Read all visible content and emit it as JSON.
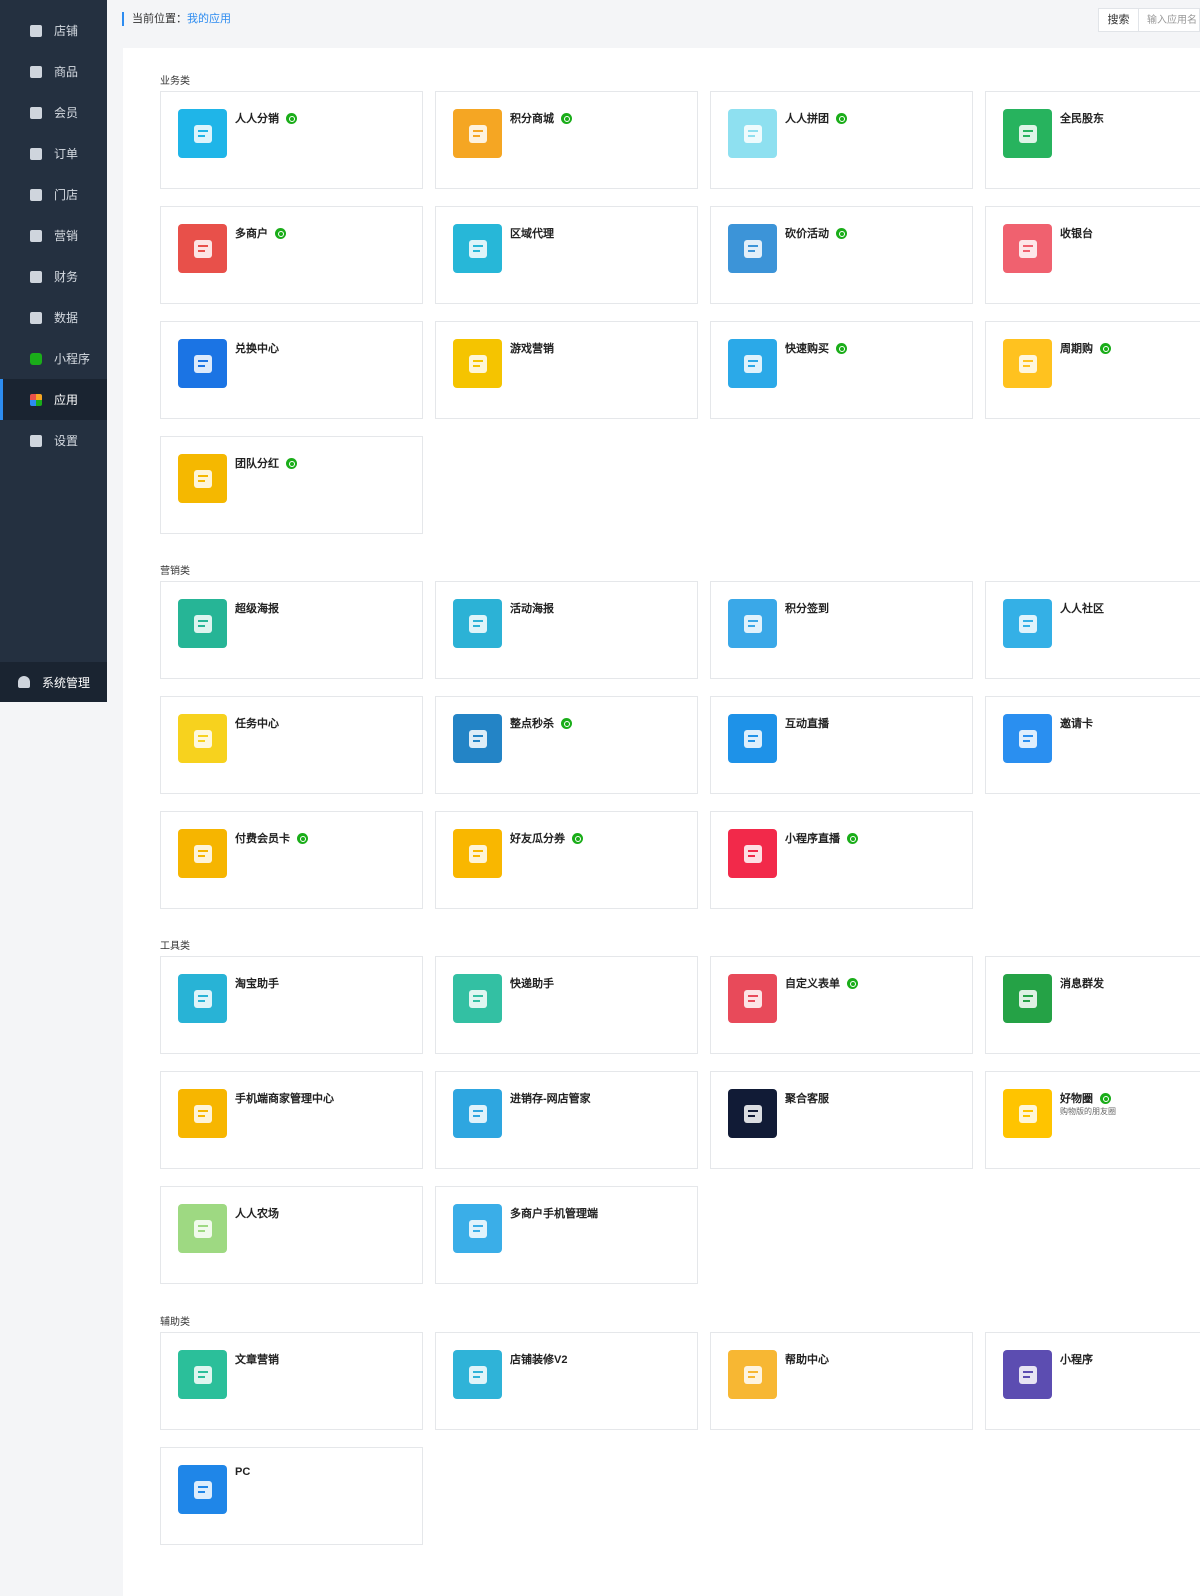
{
  "sidebar": {
    "items": [
      {
        "label": "店铺",
        "icon": "store-icon",
        "active": false
      },
      {
        "label": "商品",
        "icon": "goods-icon",
        "active": false
      },
      {
        "label": "会员",
        "icon": "user-icon",
        "active": false
      },
      {
        "label": "订单",
        "icon": "order-icon",
        "active": false
      },
      {
        "label": "门店",
        "icon": "shop-icon",
        "active": false
      },
      {
        "label": "营销",
        "icon": "gift-icon",
        "active": false
      },
      {
        "label": "财务",
        "icon": "money-bag-icon",
        "active": false
      },
      {
        "label": "数据",
        "icon": "bar-chart-icon",
        "active": false
      },
      {
        "label": "小程序",
        "icon": "miniprogram-icon",
        "active": false
      },
      {
        "label": "应用",
        "icon": "apps-grid-icon",
        "active": true
      },
      {
        "label": "设置",
        "icon": "gear-icon",
        "active": false
      }
    ],
    "bottom_label": "系统管理"
  },
  "breadcrumb": {
    "prefix": "当前位置：",
    "current": "我的应用"
  },
  "search": {
    "button_label": "搜索",
    "placeholder": "输入应用名"
  },
  "colors": {
    "sidebar_bg": "#243040",
    "accent": "#2d8cf0",
    "miniprogram_badge": "#1aad19"
  },
  "sections": [
    {
      "title": "业务类",
      "apps": [
        {
          "name": "人人分销",
          "mp": true,
          "color": "#1fb5e8",
          "icon": "distribution-icon"
        },
        {
          "name": "积分商城",
          "mp": true,
          "color": "#f5a623",
          "icon": "points-mall-icon"
        },
        {
          "name": "人人拼团",
          "mp": true,
          "color": "#8ee0f0",
          "icon": "group-buy-icon"
        },
        {
          "name": "全民股东",
          "mp": false,
          "color": "#27b35e",
          "icon": "shareholder-icon"
        },
        {
          "name": "多商户",
          "mp": true,
          "color": "#e8504a",
          "icon": "multi-merchant-icon"
        },
        {
          "name": "区域代理",
          "mp": false,
          "color": "#27b7d8",
          "icon": "map-icon"
        },
        {
          "name": "砍价活动",
          "mp": true,
          "color": "#3c94d8",
          "icon": "bargain-axe-icon"
        },
        {
          "name": "收银台",
          "mp": false,
          "color": "#f0616f",
          "icon": "cashier-icon"
        },
        {
          "name": "兑换中心",
          "mp": false,
          "color": "#1b74e4",
          "icon": "exchange-icon"
        },
        {
          "name": "游戏营销",
          "mp": false,
          "color": "#f5c400",
          "icon": "wheel-icon"
        },
        {
          "name": "快速购买",
          "mp": true,
          "color": "#2ba9e8",
          "icon": "cart-icon"
        },
        {
          "name": "周期购",
          "mp": true,
          "color": "#ffc21f",
          "icon": "calendar-icon"
        },
        {
          "name": "团队分红",
          "mp": true,
          "color": "#f5b800",
          "icon": "red-envelope-icon"
        }
      ]
    },
    {
      "title": "营销类",
      "apps": [
        {
          "name": "超级海报",
          "mp": false,
          "color": "#26b596",
          "icon": "poster-camera-icon"
        },
        {
          "name": "活动海报",
          "mp": false,
          "color": "#2cb2d6",
          "icon": "picture-icon"
        },
        {
          "name": "积分签到",
          "mp": false,
          "color": "#3aa8e8",
          "icon": "sign-pin-icon"
        },
        {
          "name": "人人社区",
          "mp": false,
          "color": "#34b0e6",
          "icon": "community-icon"
        },
        {
          "name": "任务中心",
          "mp": false,
          "color": "#f7d21e",
          "icon": "task-qrcode-icon"
        },
        {
          "name": "整点秒杀",
          "mp": true,
          "color": "#2384c6",
          "icon": "alarm-clock-icon"
        },
        {
          "name": "互动直播",
          "mp": false,
          "color": "#1e92e8",
          "icon": "tv-icon"
        },
        {
          "name": "邀请卡",
          "mp": false,
          "color": "#2a8ff0",
          "icon": "invite-card-icon"
        },
        {
          "name": "付费会员卡",
          "mp": true,
          "color": "#f6b500",
          "icon": "crown-card-icon"
        },
        {
          "name": "好友瓜分券",
          "mp": true,
          "color": "#f9b700",
          "icon": "coupon-envelope-icon"
        },
        {
          "name": "小程序直播",
          "mp": true,
          "color": "#f2294a",
          "icon": "live-tv-icon"
        }
      ]
    },
    {
      "title": "工具类",
      "apps": [
        {
          "name": "淘宝助手",
          "mp": false,
          "color": "#28b3d6",
          "icon": "taobao-face-icon"
        },
        {
          "name": "快递助手",
          "mp": false,
          "color": "#33c0a3",
          "icon": "package-icon"
        },
        {
          "name": "自定义表单",
          "mp": true,
          "color": "#e84a5a",
          "icon": "form-icon"
        },
        {
          "name": "消息群发",
          "mp": false,
          "color": "#25a246",
          "icon": "message-icon"
        },
        {
          "name": "手机端商家管理中心",
          "mp": false,
          "color": "#f7b600",
          "icon": "phone-icon"
        },
        {
          "name": "进销存-网店管家",
          "mp": false,
          "color": "#2ea6e0",
          "icon": "inventory-icon"
        },
        {
          "name": "聚合客服",
          "mp": false,
          "color": "#111b36",
          "icon": "service-face-icon"
        },
        {
          "name": "好物圈",
          "mp": true,
          "sub": "购物版的朋友圈",
          "color": "#ffc400",
          "icon": "shopping-cart-icon"
        },
        {
          "name": "人人农场",
          "mp": false,
          "color": "#9ed982",
          "icon": "chicken-icon"
        },
        {
          "name": "多商户手机管理端",
          "mp": false,
          "color": "#3aaee8",
          "icon": "mobile-manage-icon"
        }
      ]
    },
    {
      "title": "辅助类",
      "apps": [
        {
          "name": "文章营销",
          "mp": false,
          "color": "#2bbf9a",
          "icon": "article-icon"
        },
        {
          "name": "店铺装修V2",
          "mp": false,
          "color": "#2fb3d8",
          "icon": "storefront-icon"
        },
        {
          "name": "帮助中心",
          "mp": false,
          "color": "#f7b733",
          "icon": "magnifier-icon"
        },
        {
          "name": "小程序",
          "mp": false,
          "color": "#5c4db1",
          "icon": "miniprogram-logo-icon"
        },
        {
          "name": "PC",
          "mp": false,
          "color": "#1f86e8",
          "icon": "pc-icon"
        }
      ]
    }
  ]
}
